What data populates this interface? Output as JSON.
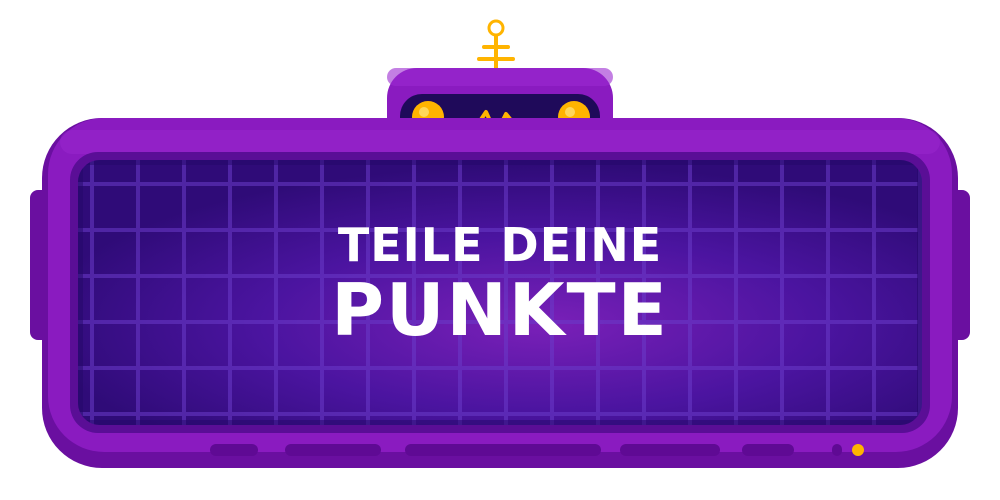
{
  "banner": {
    "title_line1": "TEILE DEINE",
    "title_line2": "PUNKTE"
  },
  "icons": {
    "antenna": "antenna-icon",
    "pulse": "pulse-wave-icon",
    "indicator_lights": "indicator-light-icon",
    "status_led": "status-led-icon"
  },
  "colors": {
    "frame_outer": "#6a0fa0",
    "frame_main": "#8a1bc0",
    "screen_dark": "#2a0a6e",
    "screen_glow": "#7a20b8",
    "accent_orange": "#ffb400",
    "text": "#ffffff"
  }
}
